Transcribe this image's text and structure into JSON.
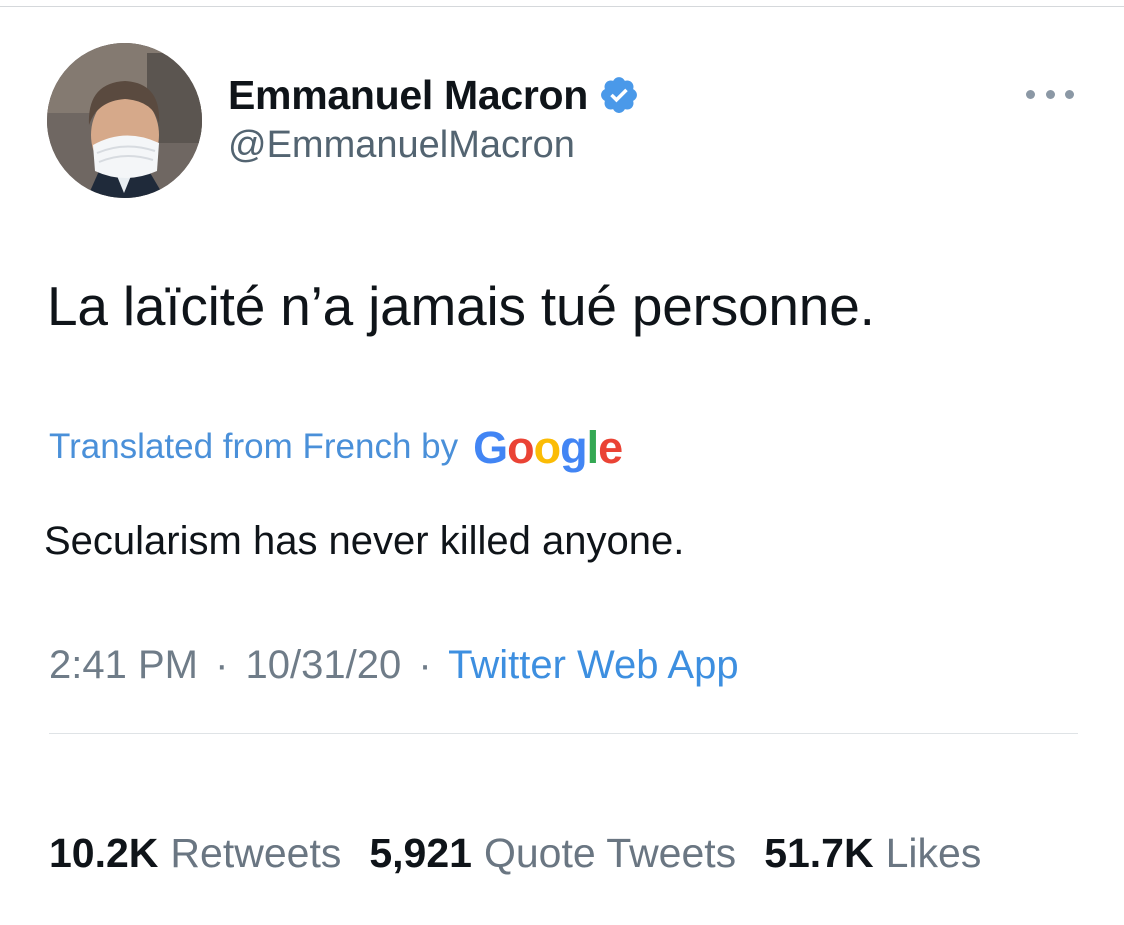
{
  "author": {
    "display_name": "Emmanuel Macron",
    "handle": "@EmmanuelMacron",
    "verified": true,
    "avatar_icon": "profile-photo-masked-man"
  },
  "tweet": {
    "text": "La laïcité n’a jamais tué personne.",
    "translation_label": "Translated from French by",
    "translation_provider": "Google",
    "translation": "Secularism has never killed anyone.",
    "time": "2:41 PM",
    "separator": "·",
    "date": "10/31/20",
    "source": "Twitter Web App"
  },
  "stats": {
    "retweets_count": "10.2K",
    "retweets_label": "Retweets",
    "quotes_count": "5,921",
    "quotes_label": "Quote Tweets",
    "likes_count": "51.7K",
    "likes_label": "Likes"
  },
  "colors": {
    "verified_badge": "#4a99e9",
    "link_blue": "#3d8fe0",
    "secondary_text": "#536471",
    "google_blue": "#4285F4",
    "google_red": "#EA4335",
    "google_yellow": "#FBBC05",
    "google_green": "#34A853"
  }
}
